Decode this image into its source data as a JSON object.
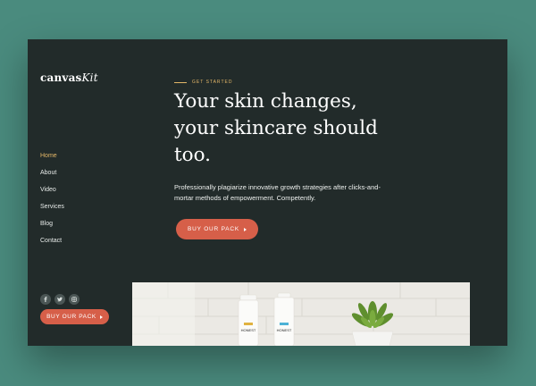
{
  "brand": {
    "logo_bold": "canvas",
    "logo_italic": "Kit"
  },
  "nav": {
    "items": [
      {
        "label": "Home",
        "active": true
      },
      {
        "label": "About",
        "active": false
      },
      {
        "label": "Video",
        "active": false
      },
      {
        "label": "Services",
        "active": false
      },
      {
        "label": "Blog",
        "active": false
      },
      {
        "label": "Contact",
        "active": false
      }
    ]
  },
  "social": {
    "icons": [
      "facebook-icon",
      "twitter-icon",
      "instagram-icon"
    ]
  },
  "sidebar_cta": {
    "label": "BUY OUR PACK"
  },
  "hero": {
    "eyebrow": "GET STARTED",
    "headline": "Your skin changes, your skincare should too.",
    "subtext": "Professionally plagiarize innovative growth strategies after clicks-and-mortar methods of empowerment. Competently.",
    "cta_label": "BUY OUR PACK"
  },
  "product_image": {
    "bottle_brand": "HONEST"
  },
  "colors": {
    "page_background": "#4a8b7e",
    "panel": "#222b2a",
    "accent": "#d65f49",
    "gold": "#e4b768"
  }
}
